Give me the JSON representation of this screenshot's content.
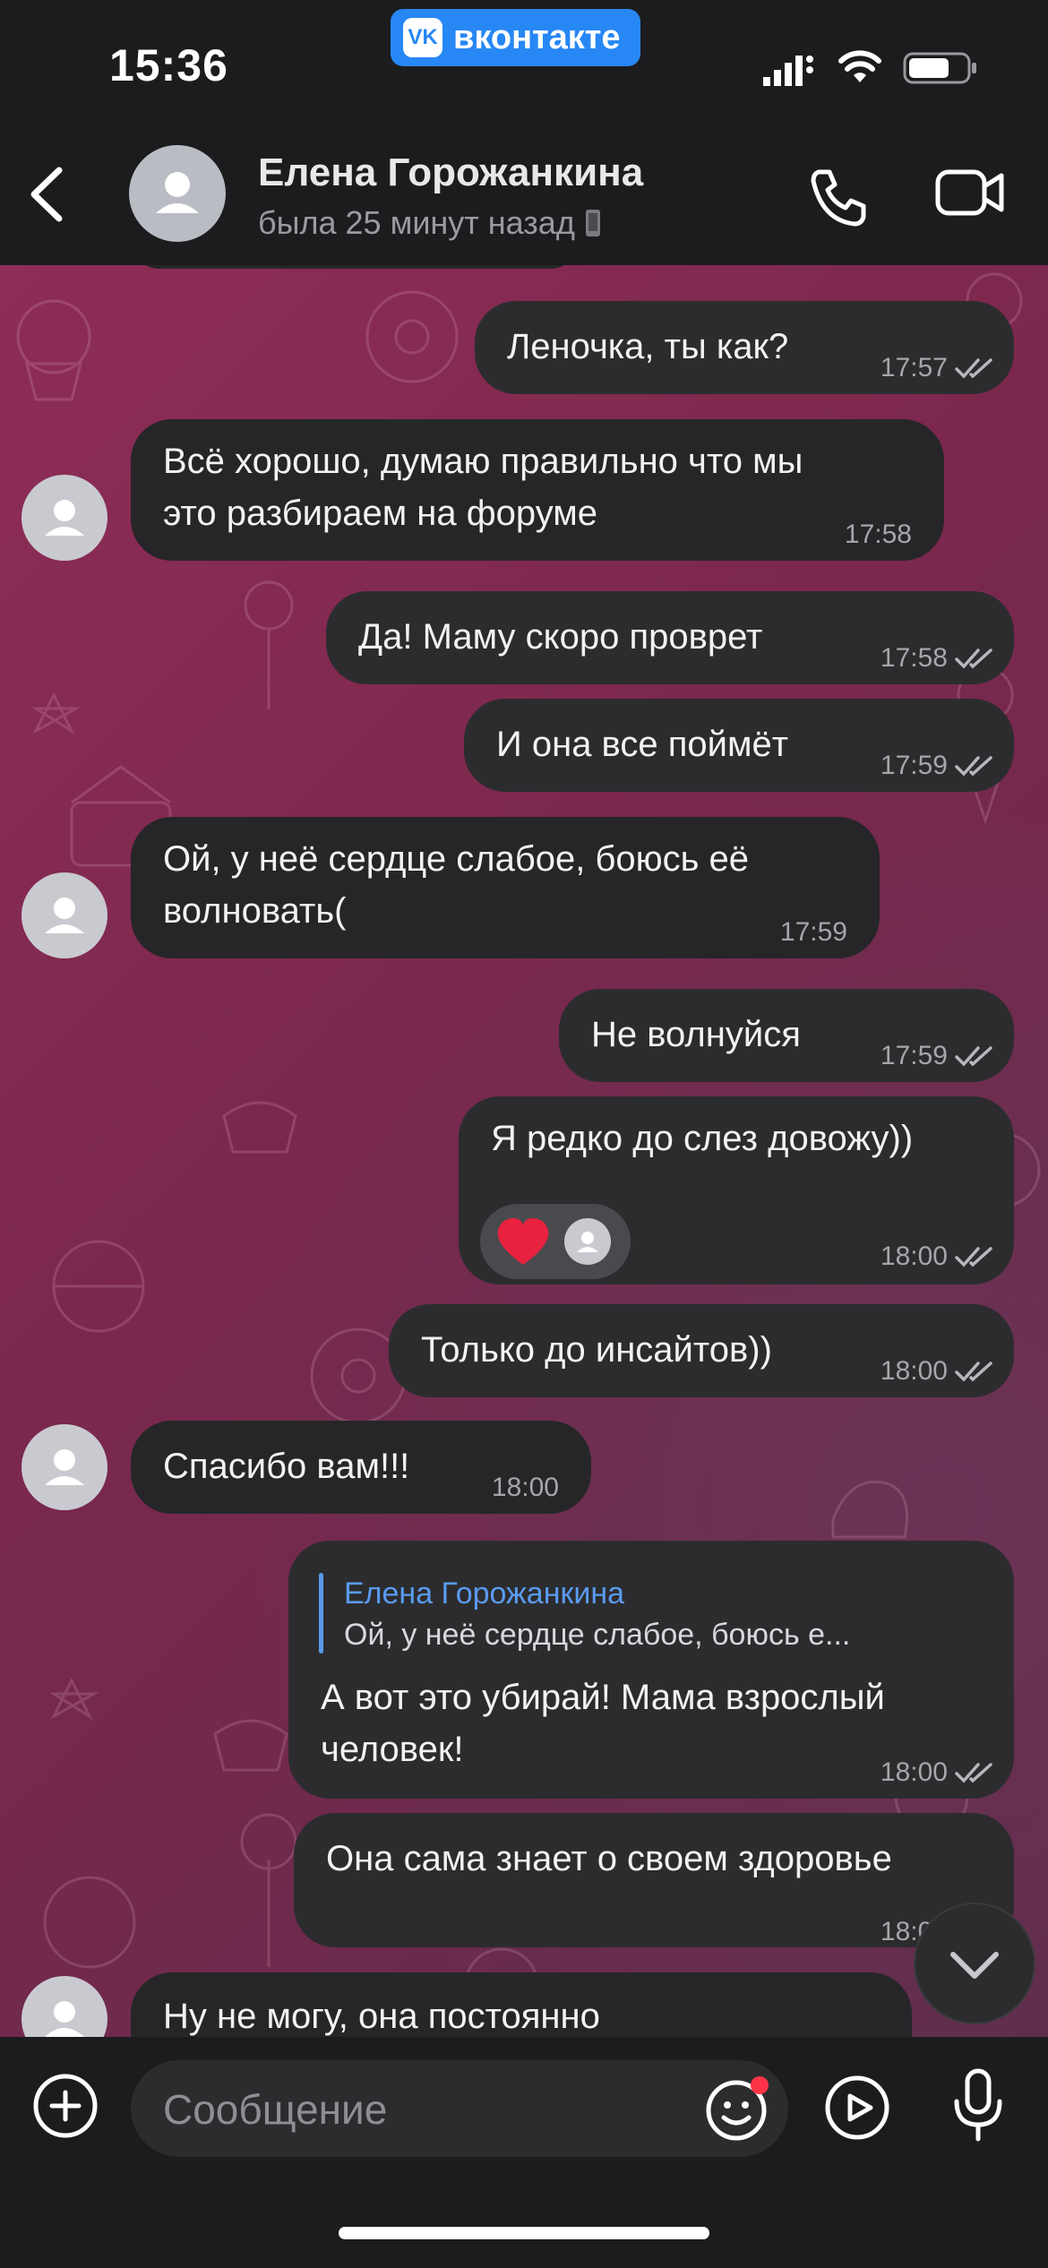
{
  "status_bar": {
    "time": "15:36",
    "app_badge": "вконтакте",
    "app_badge_logo": "VK"
  },
  "header": {
    "contact_name": "Елена Горожанкина",
    "status": "была 25 минут назад",
    "icons": [
      "back-icon",
      "avatar",
      "phone-icon",
      "video-call-icon"
    ]
  },
  "messages": [
    {
      "dir": "out",
      "text": "Леночка, ты как?",
      "time": "17:57",
      "read": true
    },
    {
      "dir": "in",
      "lines": [
        "Всё хорошо, думаю правильно что мы",
        "это разбираем на форуме"
      ],
      "time": "17:58"
    },
    {
      "dir": "out",
      "text": "Да! Маму скоро проврет",
      "time": "17:58",
      "read": true
    },
    {
      "dir": "out",
      "text": "И она все поймёт",
      "time": "17:59",
      "read": true
    },
    {
      "dir": "in",
      "lines": [
        "Ой, у неё сердце слабое, боюсь её",
        "волновать("
      ],
      "time": "17:59"
    },
    {
      "dir": "out",
      "text": "Не волнуйся",
      "time": "17:59",
      "read": true
    },
    {
      "dir": "out",
      "text": "Я редко до слез довожу))",
      "time": "18:00",
      "read": true,
      "reaction": "heart"
    },
    {
      "dir": "out",
      "text": "Только до инсайтов))",
      "time": "18:00",
      "read": true
    },
    {
      "dir": "in",
      "text": "Спасибо вам!!!",
      "time": "18:00"
    },
    {
      "dir": "out",
      "reply_to": {
        "name": "Елена Горожанкина",
        "text": "Ой, у неё сердце слабое, боюсь е..."
      },
      "lines": [
        "А вот это убирай! Мама взрослый",
        "человек!"
      ],
      "time": "18:00",
      "read": true
    },
    {
      "dir": "out",
      "text": "Она сама знает о своем здоровье",
      "time": "18:00",
      "read": true
    },
    {
      "dir": "in",
      "text": "Ну не могу, она постоянно"
    }
  ],
  "composer": {
    "placeholder": "Сообщение"
  },
  "colors": {
    "accent": "#2787f5",
    "reply_accent": "#5a9bef",
    "bubble": "#2c2c2e",
    "bar": "#1c1c1e",
    "chat_bg": "#8e2d56"
  }
}
